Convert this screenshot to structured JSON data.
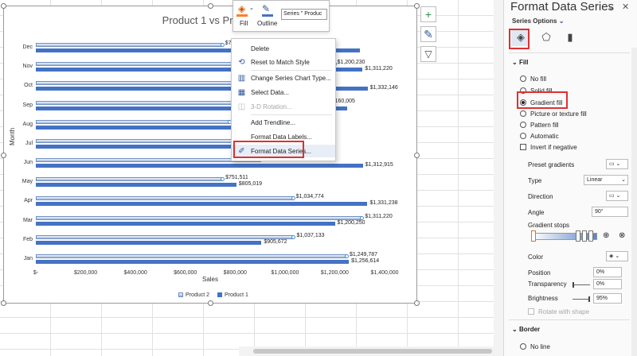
{
  "chart": {
    "title": "Product 1 vs Product",
    "y_axis_title": "Month",
    "x_axis_title": "Sales",
    "legend": [
      "Product 2",
      "Product 1"
    ]
  },
  "chart_data": {
    "type": "bar",
    "title": "Product 1 vs Product",
    "xlabel": "Sales",
    "ylabel": "Month",
    "categories": [
      "Jan",
      "Feb",
      "Mar",
      "Apr",
      "May",
      "Jun",
      "Jul",
      "Aug",
      "Sep",
      "Oct",
      "Nov",
      "Dec"
    ],
    "xlim": [
      0,
      1400000
    ],
    "x_ticks": [
      "$-",
      "$200,000",
      "$400,000",
      "$600,000",
      "$800,000",
      "$1,000,000",
      "$1,200,000",
      "$1,400,000"
    ],
    "series": [
      {
        "name": "Product 2",
        "values": [
          1249787,
          1037133,
          1311220,
          1034774,
          751511,
          900000,
          810000,
          780000,
          1160005,
          1200000,
          1200230,
          750154
        ]
      },
      {
        "name": "Product 1",
        "values": [
          1256614,
          905672,
          1200250,
          1331238,
          805019,
          1312915,
          1000736,
          800000,
          1250000,
          1332146,
          1311220,
          1300000
        ]
      }
    ],
    "data_labels": {
      "Product 2": [
        "$1,249,787",
        "$1,037,133",
        "$1,311,220",
        "$1,034,774",
        "$751,511",
        "",
        "",
        "",
        "$1,160,005",
        "",
        "$1,200,230",
        "$750,154"
      ],
      "Product 1": [
        "$1,256,614",
        "$905,672",
        "$1,200,250",
        "$1,331,238",
        "$805,019",
        "$1,312,915",
        "736",
        "",
        "",
        "$1,332,146",
        "$1,311,220",
        ""
      ]
    },
    "legend_position": "bottom"
  },
  "mini_toolbar": {
    "fill": "Fill",
    "outline": "Outline",
    "series_select": "Series \" Produc"
  },
  "context_menu": {
    "items": [
      "Delete",
      "Reset to Match Style",
      "Change Series Chart Type...",
      "Select Data...",
      "3-D Rotation...",
      "Add Trendline...",
      "Format Data Labels...",
      "Format Data Series..."
    ]
  },
  "pane": {
    "title": "Format Data Series",
    "subtitle": "Series Options",
    "fill_section": "Fill",
    "fill_options": [
      "No fill",
      "Solid fill",
      "Gradient fill",
      "Picture or texture fill",
      "Pattern fill",
      "Automatic"
    ],
    "invert": "Invert if negative",
    "preset_gradients": "Preset gradients",
    "type_label": "Type",
    "type_value": "Linear",
    "direction_label": "Direction",
    "angle_label": "Angle",
    "angle_value": "90°",
    "gradient_stops": "Gradient stops",
    "color_label": "Color",
    "position_label": "Position",
    "position_value": "0%",
    "transparency_label": "Transparency",
    "transparency_value": "0%",
    "brightness_label": "Brightness",
    "brightness_value": "95%",
    "rotate_with_shape": "Rotate with shape",
    "border_section": "Border",
    "no_line": "No line"
  }
}
